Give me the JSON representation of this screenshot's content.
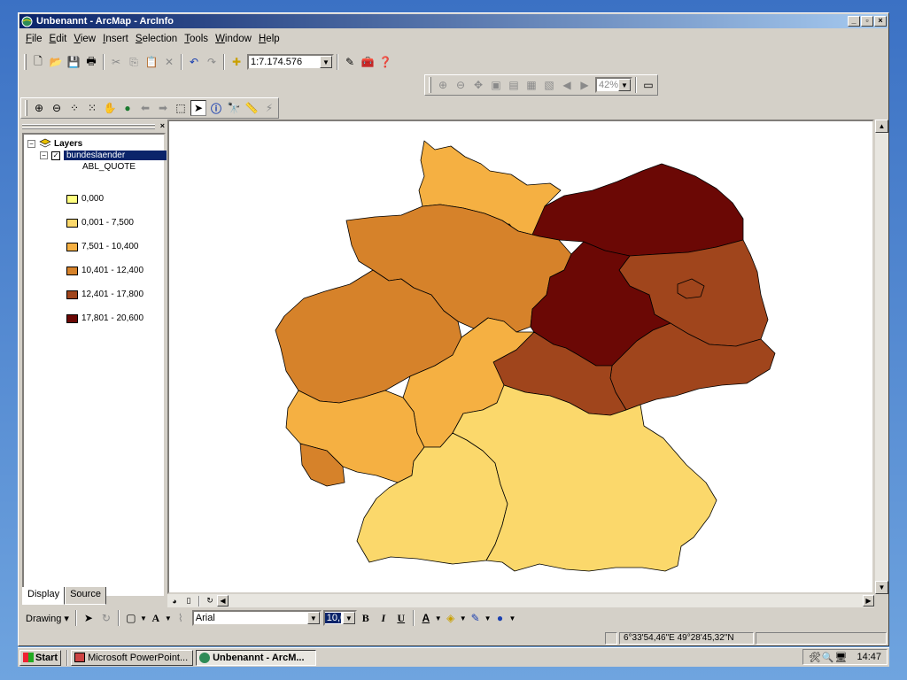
{
  "window": {
    "title": "Unbenannt - ArcMap - ArcInfo"
  },
  "menu": {
    "items": [
      {
        "u": "F",
        "rest": "ile"
      },
      {
        "u": "E",
        "rest": "dit"
      },
      {
        "u": "V",
        "rest": "iew"
      },
      {
        "u": "I",
        "rest": "nsert"
      },
      {
        "u": "S",
        "rest": "election"
      },
      {
        "u": "T",
        "rest": "ools"
      },
      {
        "u": "W",
        "rest": "indow"
      },
      {
        "u": "H",
        "rest": "elp"
      }
    ]
  },
  "toolbar": {
    "scale": "1:7.174.576",
    "zoom_percent": "42%"
  },
  "toc": {
    "root": "Layers",
    "layer": "bundeslaender",
    "field": "ABL_QUOTE",
    "legend": [
      {
        "label": "0,000",
        "color": "#ffff80"
      },
      {
        "label": "0,001 - 7,500",
        "color": "#fbd86b"
      },
      {
        "label": "7,501 - 10,400",
        "color": "#f5b042"
      },
      {
        "label": "10,401 - 12,400",
        "color": "#d6822a"
      },
      {
        "label": "12,401 - 17,800",
        "color": "#a0451c"
      },
      {
        "label": "17,801 - 20,600",
        "color": "#6b0805"
      }
    ],
    "tabs": {
      "display": "Display",
      "source": "Source"
    }
  },
  "drawing": {
    "label": "Drawing",
    "font": "Arial",
    "size": "10,0"
  },
  "status": {
    "coords": "6°33'54,46\"E  49°28'45,32\"N"
  },
  "taskbar": {
    "start": "Start",
    "items": [
      "Microsoft PowerPoint...",
      "Unbenannt - ArcM..."
    ],
    "clock": "14:47"
  }
}
